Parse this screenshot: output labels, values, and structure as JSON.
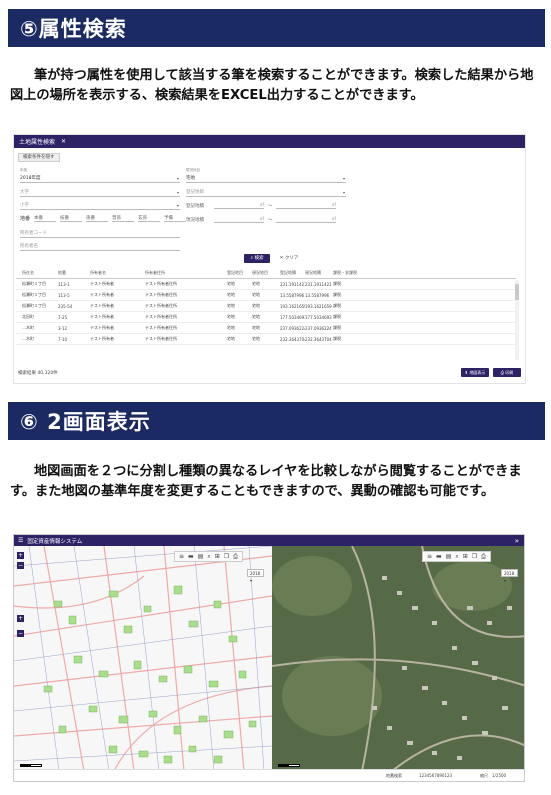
{
  "section5": {
    "title": "⑤属性検索",
    "body": "筆が持つ属性を使用して該当する筆を検索することができます。検索した結果から地図上の場所を表示する、検索結果をEXCEL出力することができます。"
  },
  "shot1": {
    "tab_title": "土地属性検索",
    "back_label": "検索条件を隠す",
    "fields": {
      "year_label": "年度",
      "year_value": "2018年度",
      "ward_placeholder": "大字",
      "chome_placeholder": "小字",
      "lot_label": "地番",
      "lot_parts": [
        "本番",
        "枝番",
        "孫番",
        "曾孫",
        "玄孫",
        "予備"
      ],
      "owner_code_placeholder": "所有者コード",
      "owner_name_placeholder": "所有者名",
      "land_type_label": "現況地目",
      "land_type_value": "宅地",
      "reg_type_placeholder": "登記地目",
      "reg_area_label": "登記地積",
      "cur_area_label": "現況地積",
      "unit": "㎡",
      "range_sep": "〜"
    },
    "search_label": "検索",
    "clear_label": "クリア",
    "columns": [
      "所在名",
      "地番",
      "所有者名",
      "所有者住所",
      "登記地目",
      "現況地目",
      "登記地積",
      "現況地積",
      "課税・非課税"
    ],
    "rows": [
      [
        "松瀬町１丁目",
        "113-1",
        "テスト所有者",
        "テスト所有者住所",
        "宅地",
        "宅地",
        "231.1911421",
        "231.1911421",
        "課税"
      ],
      [
        "松瀬町１丁目",
        "113-5",
        "テスト所有者",
        "テスト所有者住所",
        "宅地",
        "宅地",
        "13.5587996",
        "13.5587996",
        "課税"
      ],
      [
        "松瀬町１丁目",
        "235-54",
        "テスト所有者",
        "テスト所有者住所",
        "宅地",
        "宅地",
        "193.1621659",
        "193.1621659",
        "課税"
      ],
      [
        "北田町",
        "7-25",
        "テスト所有者",
        "テスト所有者住所",
        "宅地",
        "宅地",
        "177.5034693",
        "177.5034693",
        "課税"
      ],
      [
        "…木町",
        "3-12",
        "テスト所有者",
        "テスト所有者住所",
        "宅地",
        "宅地",
        "237.0936224",
        "237.0936224",
        "課税"
      ],
      [
        "…木町",
        "7-10",
        "テスト所有者",
        "テスト所有者住所",
        "宅地",
        "宅地",
        "232.3643704",
        "232.3643704",
        "課税"
      ]
    ],
    "count_label": "検索結果 40,320件",
    "map_btn": "地図表示",
    "excel_btn": "印刷"
  },
  "section6": {
    "title": "⑥ 2画面表示",
    "body": "地図画面を２つに分割し種類の異なるレイヤを比較しながら閲覧することができます。また地図の基準年度を変更することもできますので、異動の確認も可能です。"
  },
  "shot2": {
    "app_title": "固定資産情報システム",
    "year": "2018",
    "status_left": "地番検索",
    "status_code": "1234567890123",
    "scale_label": "縮尺",
    "scale_value": "1/2500"
  },
  "colors": {
    "header_bg": "#1c2a63",
    "app_bar": "#2d2266",
    "parcel_green": "#a8e08a",
    "road_pink": "#f2b6b6"
  }
}
